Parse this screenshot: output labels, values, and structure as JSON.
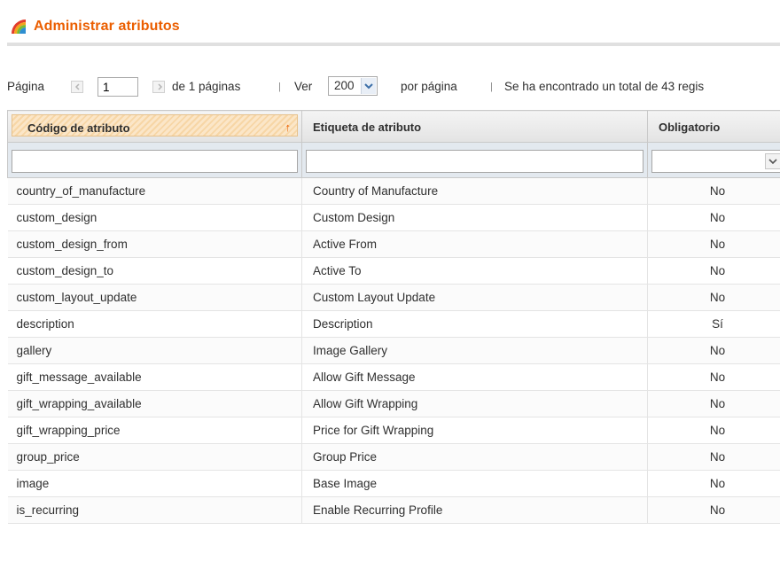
{
  "header": {
    "title": "Administrar atributos",
    "icon": "rainbow-icon",
    "title_color": "#eb5e00"
  },
  "pager": {
    "page_label": "Página",
    "page_value": "1",
    "of_pages": "de 1 páginas",
    "separator": "|",
    "view_label": "Ver",
    "per_page_value": "200",
    "per_page_label": "por página",
    "total_text": "Se ha encontrado un total de 43 regis"
  },
  "grid": {
    "columns": [
      {
        "label": "Código de atributo",
        "sorted": true,
        "sort_icon": "sort-arrow-up-icon"
      },
      {
        "label": "Etiqueta de atributo"
      },
      {
        "label": "Obligatorio"
      }
    ],
    "rows": [
      [
        "country_of_manufacture",
        "Country of Manufacture",
        "No"
      ],
      [
        "custom_design",
        "Custom Design",
        "No"
      ],
      [
        "custom_design_from",
        "Active From",
        "No"
      ],
      [
        "custom_design_to",
        "Active To",
        "No"
      ],
      [
        "custom_layout_update",
        "Custom Layout Update",
        "No"
      ],
      [
        "description",
        "Description",
        "Sí"
      ],
      [
        "gallery",
        "Image Gallery",
        "No"
      ],
      [
        "gift_message_available",
        "Allow Gift Message",
        "No"
      ],
      [
        "gift_wrapping_available",
        "Allow Gift Wrapping",
        "No"
      ],
      [
        "gift_wrapping_price",
        "Price for Gift Wrapping",
        "No"
      ],
      [
        "group_price",
        "Group Price",
        "No"
      ],
      [
        "image",
        "Base Image",
        "No"
      ],
      [
        "is_recurring",
        "Enable Recurring Profile",
        "No"
      ]
    ]
  }
}
